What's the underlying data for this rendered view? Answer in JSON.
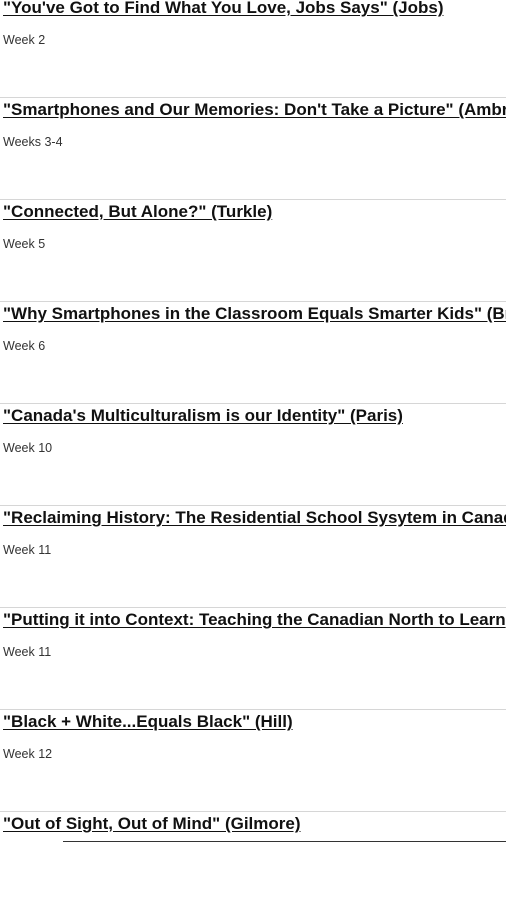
{
  "entries": [
    {
      "title": "\"You've Got to Find What You Love, Jobs Says\" (Jobs)",
      "week": "Week 2"
    },
    {
      "title": "\"Smartphones and Our Memories: Don't Take a Picture\" (Ambr",
      "week": "Weeks 3-4"
    },
    {
      "title": "\"Connected, But Alone?\" (Turkle)",
      "week": "Week 5"
    },
    {
      "title": "\"Why Smartphones in the Classroom Equals Smarter Kids\" (Br",
      "week": "Week 6"
    },
    {
      "title": "\"Canada's Multiculturalism is our Identity\" (Paris)",
      "week": "Week 10"
    },
    {
      "title": "\"Reclaiming History: The Residential School Sysytem in Canad",
      "week": "Week 11"
    },
    {
      "title": "\"Putting it into Context: Teaching the Canadian North to Learn",
      "week": "Week 11"
    },
    {
      "title": "\"Black + White...Equals Black\" (Hill)",
      "week": "Week 12"
    },
    {
      "title": "\"Out of Sight, Out of Mind\" (Gilmore)",
      "week": ""
    }
  ]
}
